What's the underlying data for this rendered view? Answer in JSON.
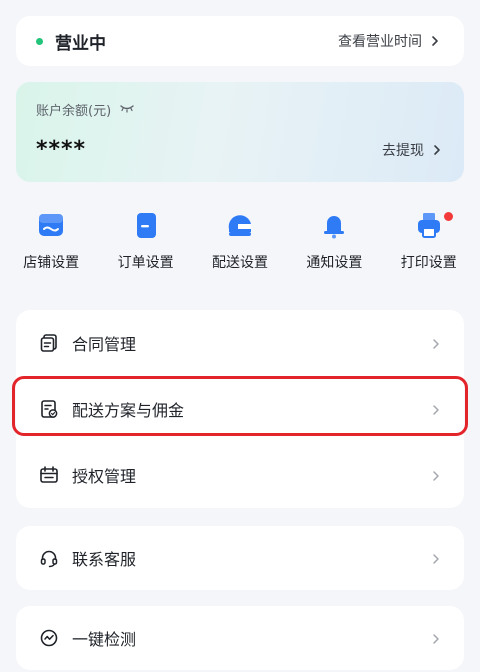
{
  "status": {
    "text": "营业中",
    "link": "查看营业时间"
  },
  "balance": {
    "label": "账户余额(元)",
    "value": "****",
    "withdraw": "去提现"
  },
  "actions": [
    {
      "label": "店铺设置",
      "icon": "store-icon"
    },
    {
      "label": "订单设置",
      "icon": "order-icon"
    },
    {
      "label": "配送设置",
      "icon": "delivery-helmet-icon"
    },
    {
      "label": "通知设置",
      "icon": "bell-icon"
    },
    {
      "label": "打印设置",
      "icon": "printer-icon"
    }
  ],
  "menu": {
    "group1": [
      {
        "label": "合同管理",
        "icon": "contract-icon"
      },
      {
        "label": "配送方案与佣金",
        "icon": "delivery-plan-icon"
      },
      {
        "label": "授权管理",
        "icon": "authorization-icon"
      }
    ],
    "group2": [
      {
        "label": "联系客服",
        "icon": "headset-icon"
      }
    ],
    "group3": [
      {
        "label": "一键检测",
        "icon": "check-icon"
      }
    ]
  },
  "colors": {
    "accent": "#2f7bf6",
    "status_green": "#22c47a",
    "badge_red": "#f23a3a",
    "highlight": "#e3242b"
  }
}
